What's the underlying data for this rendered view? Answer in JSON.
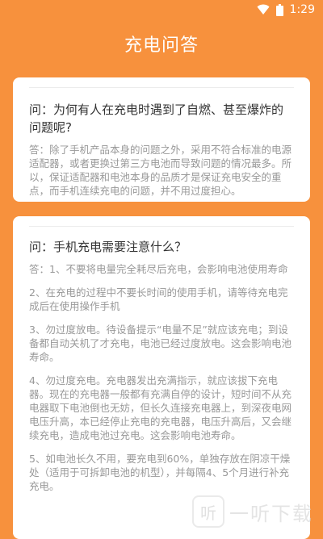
{
  "status_bar": {
    "time": "1:29",
    "icons": [
      "wifi-icon",
      "battery-icon"
    ]
  },
  "header": {
    "title": "充电问答"
  },
  "cards": [
    {
      "question": "问：为何有人在充电时遇到了自燃、甚至爆炸的问题呢?",
      "answers": [
        "答：除了手机产品本身的问题之外，采用不符合标准的电源适配器，或者更换过第三方电池而导致问题的情况最多。所以，保证适配器和电池本身的品质才是保证充电安全的重点，而手机连续充电的问题，并不用过度担心。"
      ]
    },
    {
      "question": "问：手机充电需要注意什么？",
      "answers": [
        "答：1、不要将电量完全耗尽后充电，会影响电池使用寿命",
        "2、在充电的过程中不要长时间的使用手机，请等待充电完成后在使用操作手机",
        "3、勿过度放电。待设备提示“电量不足”就应该充电；到设备都自动关机了才充电，电池已经过度放电。这会影响电池寿命。",
        "4、勿过度充电。充电器发出充满指示，就应该拔下充电器。现在的充电器一般都有充满自停的设计，短时间不从充电器取下电池倒也无妨，但长久连接充电器上，到深夜电网电压升高，本已经停止充电的充电器，电压升高后，又会继续充电，造成电池过充电。这会影响电池寿命。",
        "5、如电池长久不用，要充电到60%，单独存放在阴凉干燥处（适用于可拆卸电池的机型），并每隔4、5个月进行补充充电。"
      ]
    }
  ],
  "watermark": {
    "logo": "听",
    "text": "一听下载"
  },
  "colors": {
    "background": "#F7913D",
    "card": "#FFFFFF",
    "question": "#333333",
    "answer": "#999999"
  }
}
